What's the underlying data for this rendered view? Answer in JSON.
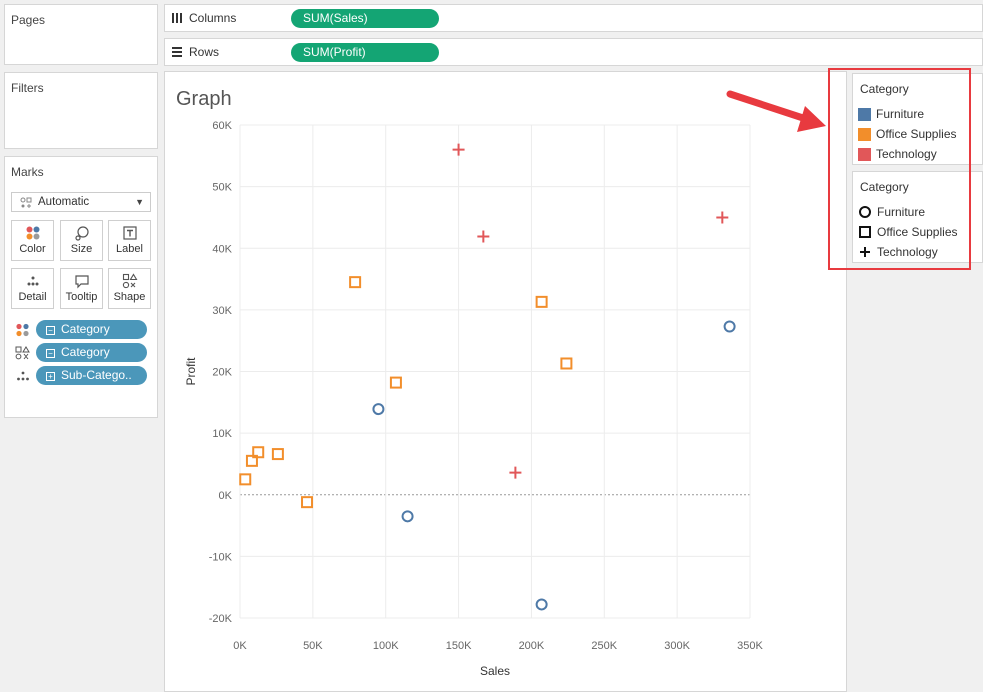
{
  "shelves": {
    "pages_label": "Pages",
    "filters_label": "Filters",
    "columns": {
      "label": "Columns",
      "pill": "SUM(Sales)"
    },
    "rows": {
      "label": "Rows",
      "pill": "SUM(Profit)"
    }
  },
  "marks": {
    "title": "Marks",
    "mark_type": "Automatic",
    "buttons": {
      "color": "Color",
      "size": "Size",
      "label": "Label",
      "detail": "Detail",
      "tooltip": "Tooltip",
      "shape": "Shape"
    },
    "fields": [
      {
        "encoding": "color",
        "name": "Category",
        "box": "−"
      },
      {
        "encoding": "shape",
        "name": "Category",
        "box": "−"
      },
      {
        "encoding": "detail",
        "name": "Sub-Catego..",
        "box": "+"
      }
    ]
  },
  "view": {
    "title": "Graph"
  },
  "legends": {
    "color": {
      "title": "Category",
      "items": [
        {
          "label": "Furniture",
          "color": "#4e79a7"
        },
        {
          "label": "Office Supplies",
          "color": "#f28e2b"
        },
        {
          "label": "Technology",
          "color": "#e15759"
        }
      ]
    },
    "shape": {
      "title": "Category",
      "items": [
        {
          "label": "Furniture",
          "shape": "circle"
        },
        {
          "label": "Office Supplies",
          "shape": "square"
        },
        {
          "label": "Technology",
          "shape": "plus"
        }
      ]
    }
  },
  "annotation": {
    "arrow_color": "#e83a3f",
    "highlight_color": "#e83a3f"
  },
  "chart_data": {
    "type": "scatter",
    "xlabel": "Sales",
    "ylabel": "Profit",
    "xlim": [
      0,
      350000
    ],
    "ylim": [
      -20000,
      60000
    ],
    "x_ticks": [
      0,
      50000,
      100000,
      150000,
      200000,
      250000,
      300000,
      350000
    ],
    "x_tick_labels": [
      "0K",
      "50K",
      "100K",
      "150K",
      "200K",
      "250K",
      "300K",
      "350K"
    ],
    "y_ticks": [
      -20000,
      -10000,
      0,
      10000,
      20000,
      30000,
      40000,
      50000,
      60000
    ],
    "y_tick_labels": [
      "-20K",
      "-10K",
      "0K",
      "10K",
      "20K",
      "30K",
      "40K",
      "50K",
      "60K"
    ],
    "grid": true,
    "zero_line": true,
    "series": [
      {
        "name": "Furniture",
        "color": "#4e79a7",
        "shape": "circle",
        "points": [
          {
            "x": 336000,
            "y": 27300
          },
          {
            "x": 95000,
            "y": 13900
          },
          {
            "x": 115000,
            "y": -3500
          },
          {
            "x": 207000,
            "y": -17800
          }
        ]
      },
      {
        "name": "Office Supplies",
        "color": "#f28e2b",
        "shape": "square",
        "points": [
          {
            "x": 79000,
            "y": 34500
          },
          {
            "x": 207000,
            "y": 31300
          },
          {
            "x": 224000,
            "y": 21300
          },
          {
            "x": 107000,
            "y": 18200
          },
          {
            "x": 12500,
            "y": 6900
          },
          {
            "x": 26000,
            "y": 6600
          },
          {
            "x": 8200,
            "y": 5500
          },
          {
            "x": 3600,
            "y": 2500
          },
          {
            "x": 46000,
            "y": -1200
          }
        ]
      },
      {
        "name": "Technology",
        "color": "#e15759",
        "shape": "plus",
        "points": [
          {
            "x": 150000,
            "y": 56000
          },
          {
            "x": 331000,
            "y": 45000
          },
          {
            "x": 167000,
            "y": 41900
          },
          {
            "x": 189000,
            "y": 3600
          }
        ]
      }
    ]
  }
}
